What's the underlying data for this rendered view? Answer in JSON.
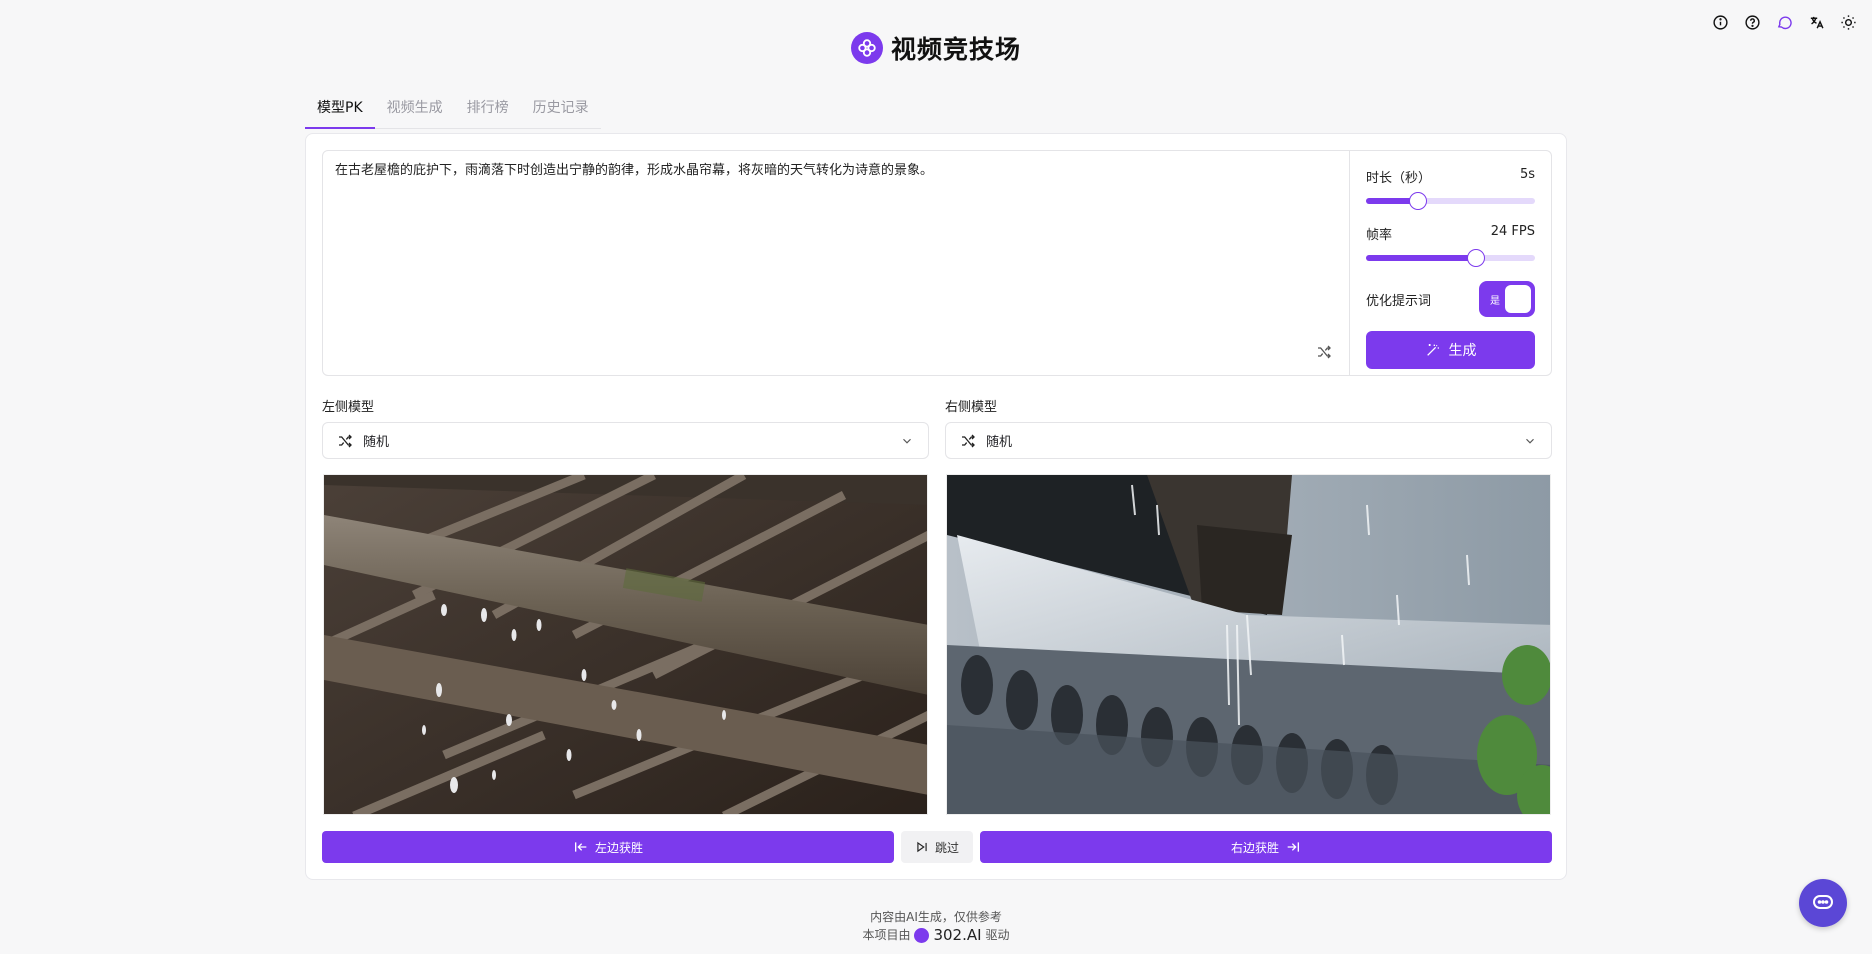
{
  "app": {
    "title": "视频竞技场",
    "accent_color": "#7c3aed"
  },
  "top_icons": [
    "info-icon",
    "help-icon",
    "chat-bubble-icon",
    "translate-icon",
    "sun-icon"
  ],
  "tabs": [
    {
      "label": "模型PK",
      "active": true
    },
    {
      "label": "视频生成",
      "active": false
    },
    {
      "label": "排行榜",
      "active": false
    },
    {
      "label": "历史记录",
      "active": false
    }
  ],
  "prompt": {
    "text": "在古老屋檐的庇护下，雨滴落下时创造出宁静的韵律，形成水晶帘幕，将灰暗的天气转化为诗意的景象。"
  },
  "settings": {
    "duration": {
      "label": "时长（秒）",
      "value_label": "5s",
      "fraction": 0.31
    },
    "framerate": {
      "label": "帧率",
      "value_label": "24 FPS",
      "fraction": 0.65
    },
    "optimize": {
      "label": "优化提示词",
      "toggle_label": "是",
      "enabled": true
    },
    "generate_label": "生成"
  },
  "left_model": {
    "label": "左侧模型",
    "value": "随机"
  },
  "right_model": {
    "label": "右侧模型",
    "value": "随机"
  },
  "actions": {
    "left_wins": "左边获胜",
    "skip": "跳过",
    "right_wins": "右边获胜"
  },
  "footer": {
    "line1": "内容由AI生成，仅供参考",
    "line2_prefix": "本项目由",
    "brand": "302.AI",
    "line2_suffix": "驱动"
  }
}
